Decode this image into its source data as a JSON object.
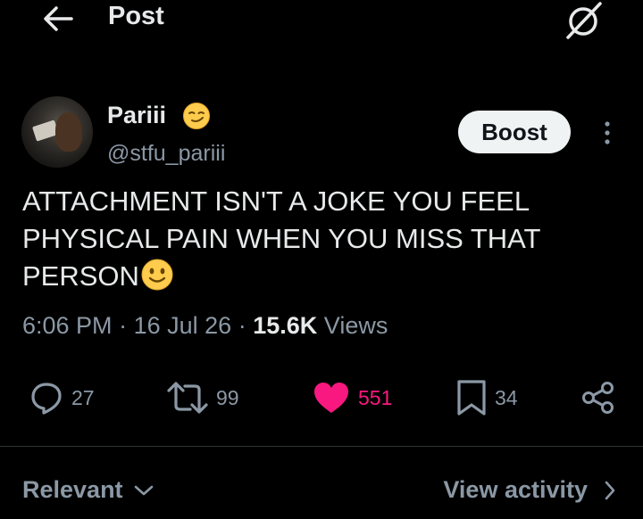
{
  "header": {
    "title": "Post",
    "back_icon": "arrow-left-icon",
    "grok_icon": "grok-icon"
  },
  "author": {
    "display_name": "Pariii",
    "name_emoji": "smirking-face-emoji",
    "handle": "@stfu_pariii",
    "boost_label": "Boost"
  },
  "post": {
    "text": "ATTACHMENT ISN'T A JOKE YOU FEEL PHYSICAL PAIN WHEN YOU MISS THAT PERSON",
    "trailing_emoji": "slightly-smiling-face-emoji",
    "time": "6:06 PM",
    "date": "16 Jul 26",
    "views_count": "15.6K",
    "views_label": "Views",
    "separator": "·"
  },
  "actions": {
    "replies": "27",
    "reposts": "99",
    "likes": "551",
    "bookmarks": "34"
  },
  "footer": {
    "sort_label": "Relevant",
    "activity_label": "View activity"
  },
  "colors": {
    "background": "#000000",
    "text_primary": "#e7e9ea",
    "text_secondary": "#8b98a5",
    "like": "#f91880",
    "button_bg": "#eff3f4",
    "divider": "#2f3336"
  }
}
